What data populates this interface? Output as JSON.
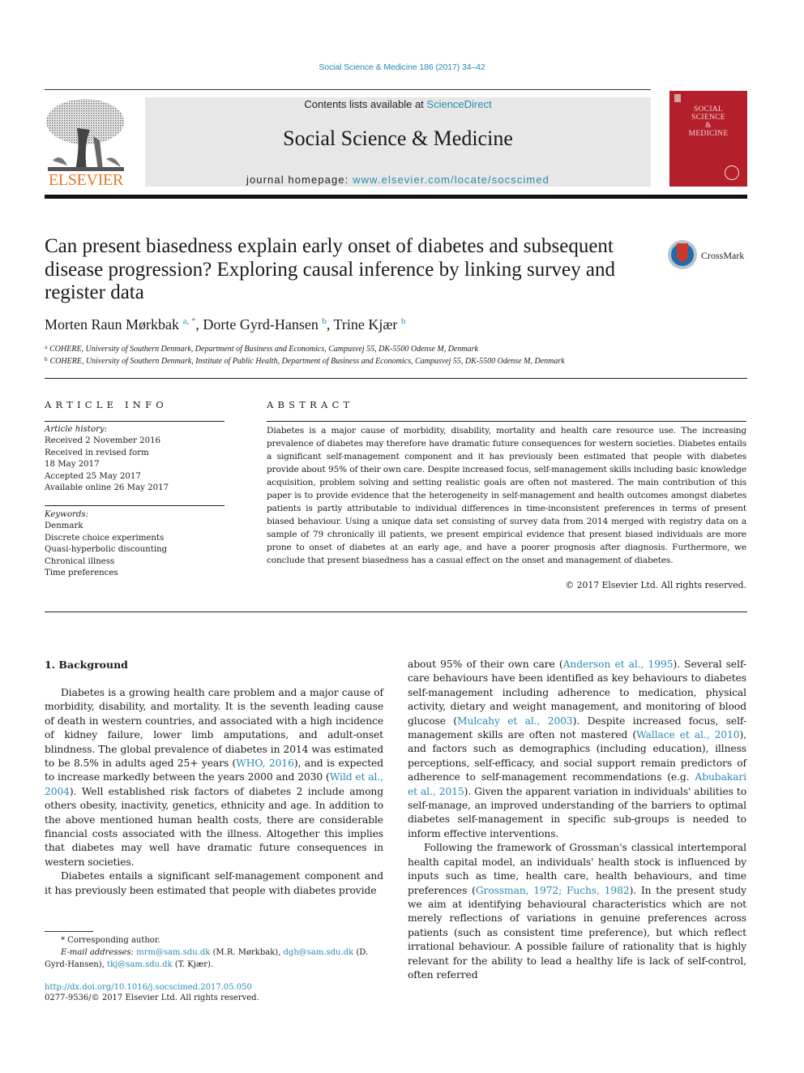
{
  "running_head": "Social Science & Medicine 186 (2017) 34–42",
  "masthead": {
    "publisher_logo_text": "ELSEVIER",
    "contents_prefix": "Contents lists available at ",
    "contents_link": "ScienceDirect",
    "journal_title": "Social Science & Medicine",
    "homepage_prefix": "journal homepage: ",
    "homepage_link": "www.elsevier.com/locate/socscimed",
    "cover_title_lines": [
      "SOCIAL",
      "SCIENCE",
      "&",
      "MEDICINE"
    ]
  },
  "colors": {
    "link": "#2a8ab0",
    "elsevier_orange": "#e87722",
    "cover_red": "#b3202c",
    "masthead_gray": "#e7e7e7"
  },
  "article": {
    "title": "Can present biasedness explain early onset of diabetes and subsequent disease progression? Exploring causal inference by linking survey and register data",
    "crossmark_label": "CrossMark",
    "authors": [
      {
        "name": "Morten Raun Mørkbak",
        "sup": "a, *"
      },
      {
        "name": "Dorte Gyrd-Hansen",
        "sup": "b"
      },
      {
        "name": "Trine Kjær",
        "sup": "b"
      }
    ],
    "affiliations": [
      {
        "key": "a",
        "text": "COHERE, University of Southern Denmark, Department of Business and Economics, Campusvej 55, DK-5500 Odense M, Denmark"
      },
      {
        "key": "b",
        "text": "COHERE, University of Southern Denmark, Institute of Public Health, Department of Business and Economics, Campusvej 55, DK-5500 Odense M, Denmark"
      }
    ]
  },
  "article_info": {
    "label": "ARTICLE INFO",
    "history_label": "Article history:",
    "history": [
      "Received 2 November 2016",
      "Received in revised form",
      "18 May 2017",
      "Accepted 25 May 2017",
      "Available online 26 May 2017"
    ],
    "keywords_label": "Keywords:",
    "keywords": [
      "Denmark",
      "Discrete choice experiments",
      "Quasi-hyperbolic discounting",
      "Chronical illness",
      "Time preferences"
    ]
  },
  "abstract": {
    "label": "ABSTRACT",
    "text": "Diabetes is a major cause of morbidity, disability, mortality and health care resource use. The increasing prevalence of diabetes may therefore have dramatic future consequences for western societies. Diabetes entails a significant self-management component and it has previously been estimated that people with diabetes provide about 95% of their own care. Despite increased focus, self-management skills including basic knowledge acquisition, problem solving and setting realistic goals are often not mastered. The main contribution of this paper is to provide evidence that the heterogeneity in self-management and health outcomes amongst diabetes patients is partly attributable to individual differences in time-inconsistent preferences in terms of present biased behaviour. Using a unique data set consisting of survey data from 2014 merged with registry data on a sample of 79 chronically ill patients, we present empirical evidence that present biased individuals are more prone to onset of diabetes at an early age, and have a poorer prognosis after diagnosis. Furthermore, we conclude that present biasedness has a casual effect on the onset and management of diabetes.",
    "copyright": "© 2017 Elsevier Ltd. All rights reserved."
  },
  "body": {
    "section_heading": "1.  Background",
    "left_p1": [
      {
        "t": "Diabetes is a growing health care problem and a major cause of morbidity, disability, and mortality. It is the seventh leading cause of death in western countries, and associated with a high incidence of kidney failure, lower limb amputations, and adult-onset blindness. The global prevalence of diabetes in 2014 was estimated to be 8.5% in adults aged 25+ years ("
      },
      {
        "link": "WHO, 2016"
      },
      {
        "t": "), and is expected to increase markedly between the years 2000 and 2030 ("
      },
      {
        "link": "Wild et al., 2004"
      },
      {
        "t": "). Well established risk factors of diabetes 2 include among others obesity, inactivity, genetics, ethnicity and age. In addition to the above mentioned human health costs, there are considerable financial costs associated with the illness. Altogether this implies that diabetes may well have dramatic future consequences in western societies."
      }
    ],
    "left_p2": [
      {
        "t": "Diabetes entails a significant self-management component and it has previously been estimated that people with diabetes provide"
      }
    ],
    "right_p1": [
      {
        "t": "about 95% of their own care ("
      },
      {
        "link": "Anderson et al., 1995"
      },
      {
        "t": "). Several self-care behaviours have been identified as key behaviours to diabetes self-management including adherence to medication, physical activity, dietary and weight management, and monitoring of blood glucose ("
      },
      {
        "link": "Mulcahy et al., 2003"
      },
      {
        "t": "). Despite increased focus, self-management skills are often not mastered ("
      },
      {
        "link": "Wallace et al., 2010"
      },
      {
        "t": "), and factors such as demographics (including education), illness perceptions, self-efficacy, and social support remain predictors of adherence to self-management recommendations (e.g. "
      },
      {
        "link": "Abubakari et al., 2015"
      },
      {
        "t": "). Given the apparent variation in individuals' abilities to self-manage, an improved understanding of the barriers to optimal diabetes self-management in specific sub-groups is needed to inform effective interventions."
      }
    ],
    "right_p2": [
      {
        "t": "Following the framework of Grossman's classical intertemporal health capital model, an individuals' health stock is influenced by inputs such as time, health care, health behaviours, and time preferences ("
      },
      {
        "link": "Grossman, 1972; Fuchs, 1982"
      },
      {
        "t": "). In the present study we aim at identifying behavioural characteristics which are not merely reflections of variations in genuine preferences across patients (such as consistent time preference), but which reflect irrational behaviour. A possible failure of rationality that is highly relevant for the ability to lead a healthy life is lack of self-control, often referred"
      }
    ]
  },
  "footnotes": {
    "corresponding": "* Corresponding author.",
    "email_label": "E-mail addresses:",
    "emails": [
      {
        "addr": "mrm@sam.sdu.dk",
        "who": " (M.R. Mørkbak), "
      },
      {
        "addr": "dgh@sam.sdu.dk",
        "who": " (D. Gyrd-Hansen), "
      },
      {
        "addr": "tkj@sam.sdu.dk",
        "who": " (T. Kjær)."
      }
    ],
    "doi": "http://dx.doi.org/10.1016/j.socscimed.2017.05.050",
    "issn": "0277-9536/© 2017 Elsevier Ltd. All rights reserved."
  }
}
